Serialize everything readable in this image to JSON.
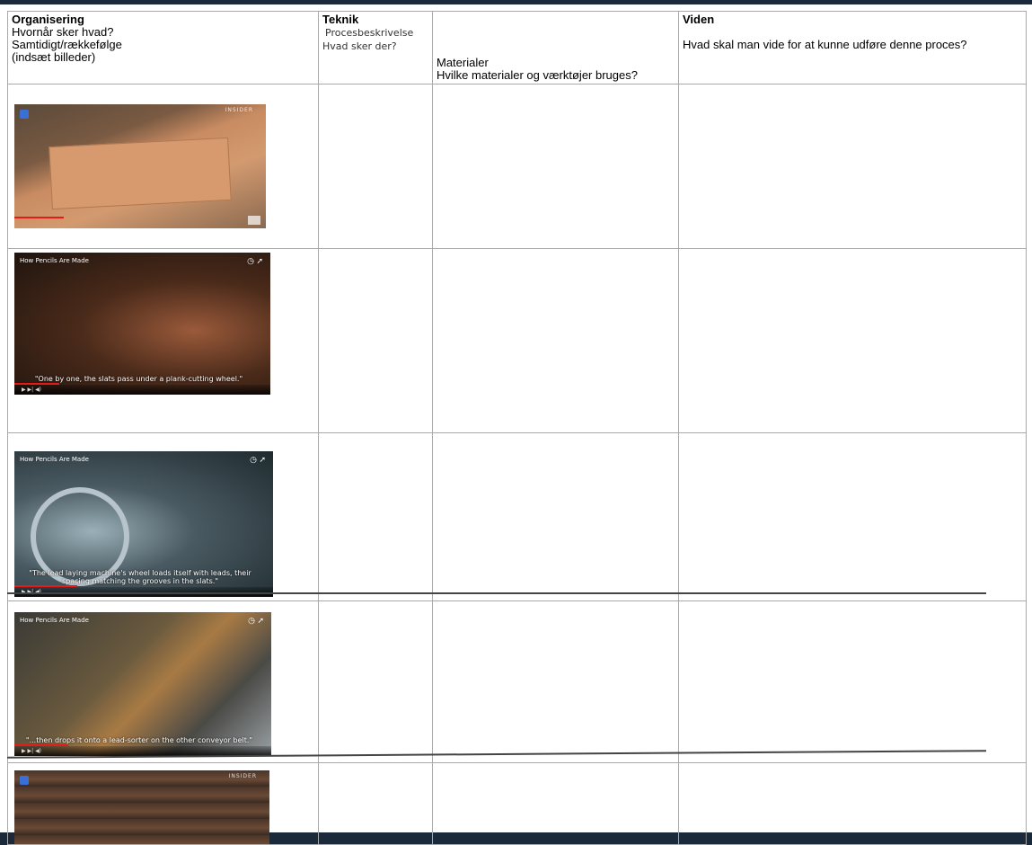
{
  "headers": {
    "organisering": {
      "title": "Organisering",
      "line1": "Hvornår sker hvad?",
      "line2": "Samtidigt/rækkefølge",
      "line3": "(indsæt billeder)"
    },
    "teknik": {
      "title": "Teknik",
      "line1": "Procesbeskrivelse",
      "line2": "Hvad sker der?"
    },
    "materialer": {
      "line1": "Materialer",
      "line2": "Hvilke materialer og værktøjer bruges?"
    },
    "viden": {
      "title": "Viden",
      "line1": "Hvad skal man vide for at kunne udføre denne proces?"
    }
  },
  "videos": {
    "v1": {
      "brand": "INSIDER"
    },
    "v2": {
      "title": "How Pencils Are Made",
      "caption": "\"One by one, the slats pass under a plank-cutting wheel.\""
    },
    "v3": {
      "title": "How Pencils Are Made",
      "caption": "\"The lead laying machine's wheel loads itself with leads, their spacing matching the grooves in the slats.\""
    },
    "v4": {
      "title": "How Pencils Are Made",
      "caption": "\"...then drops it onto a lead-sorter on the other conveyor belt.\""
    },
    "v5": {
      "brand": "INSIDER"
    }
  },
  "colors": {
    "frame": "#1b2a3a",
    "border": "#a9a9a9",
    "progress": "#e21b1b"
  }
}
